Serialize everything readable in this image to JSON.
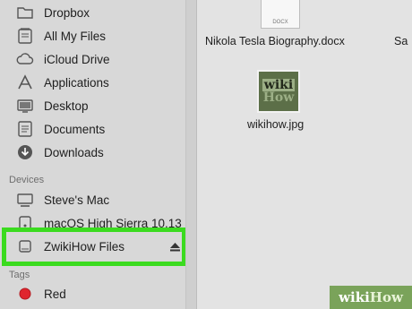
{
  "sidebar": {
    "favorites": [
      {
        "label": "Dropbox",
        "icon": "folder-icon"
      },
      {
        "label": "All My Files",
        "icon": "all-files-icon"
      },
      {
        "label": "iCloud Drive",
        "icon": "cloud-icon"
      },
      {
        "label": "Applications",
        "icon": "applications-icon"
      },
      {
        "label": "Desktop",
        "icon": "desktop-icon"
      },
      {
        "label": "Documents",
        "icon": "documents-icon"
      },
      {
        "label": "Downloads",
        "icon": "download-icon"
      }
    ],
    "devices_header": "Devices",
    "devices": [
      {
        "label": "Steve's Mac",
        "icon": "computer-icon"
      },
      {
        "label": "macOS High Sierra 10.13",
        "icon": "disk-icon"
      },
      {
        "label": "ZwikiHow Files",
        "icon": "drive-icon",
        "selected": true
      }
    ],
    "tags_header": "Tags",
    "tags": [
      {
        "label": "Red",
        "color": "#e0262e"
      }
    ]
  },
  "files": [
    {
      "name": "Nikola Tesla Biography.docx",
      "type_label": "DOCX"
    },
    {
      "name": "wikihow.jpg",
      "thumb_top": "wiki",
      "thumb_bottom": "How"
    },
    {
      "name": "Sa"
    }
  ],
  "watermark": {
    "part1": "wiki",
    "part2": "How"
  },
  "colors": {
    "highlight": "#3bdb1f",
    "watermark": "#7aa35a"
  }
}
